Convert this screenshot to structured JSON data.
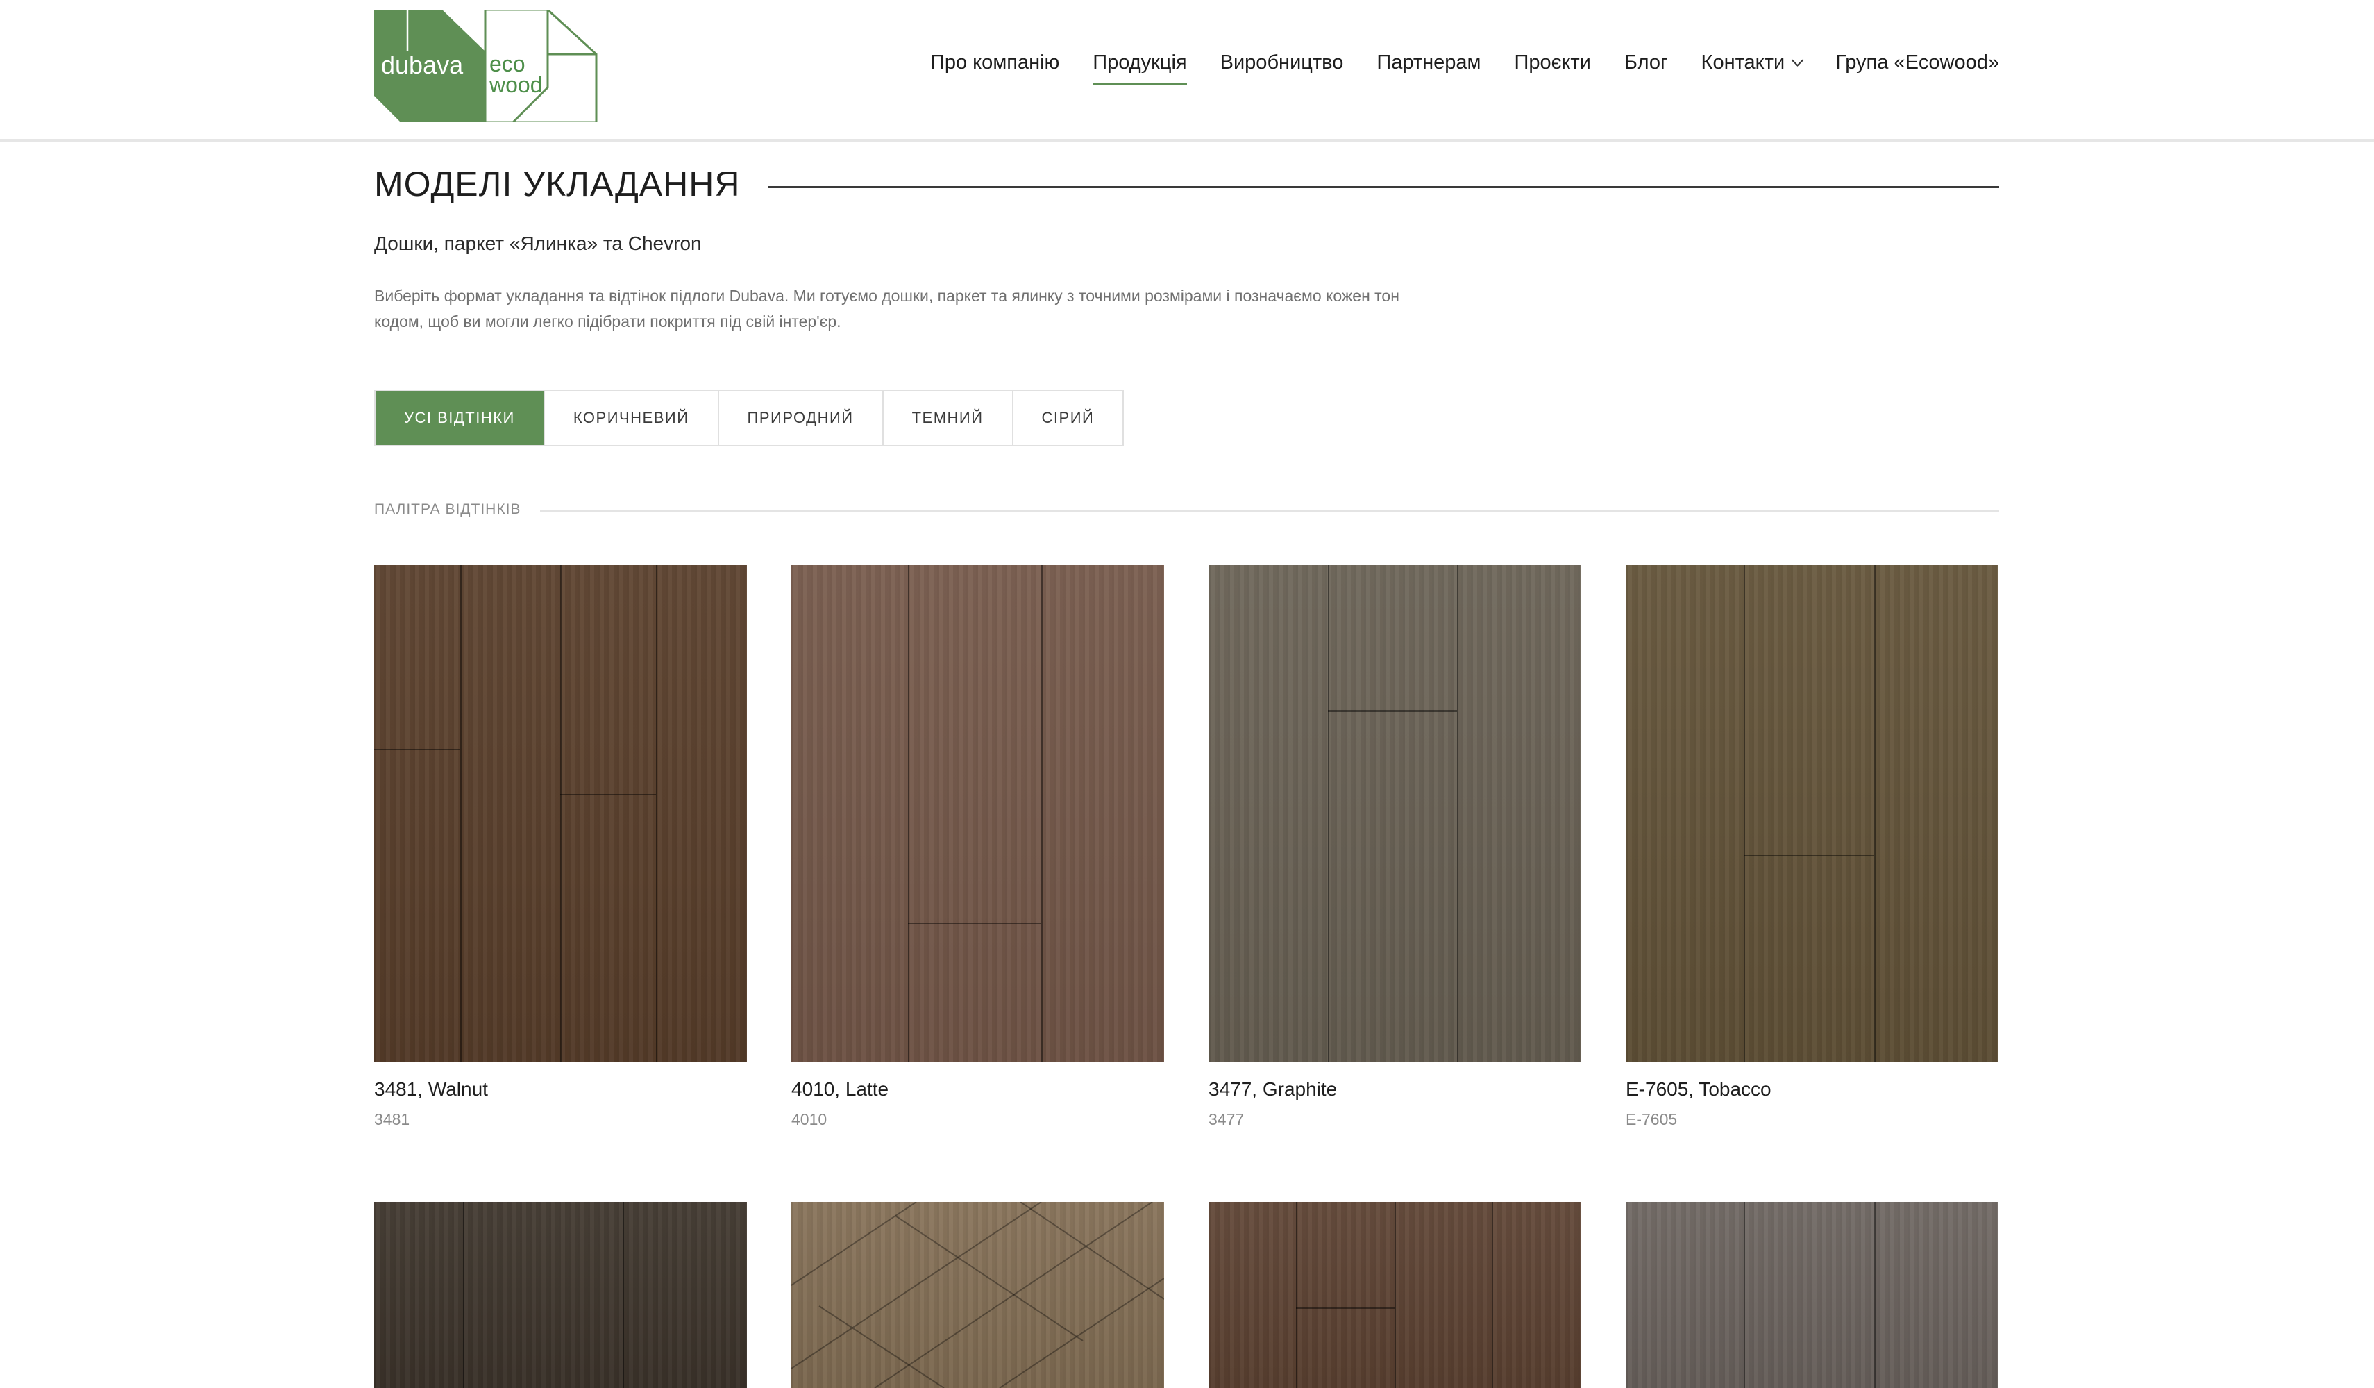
{
  "header": {
    "logo": {
      "brand": "dubava",
      "sub1": "eco",
      "sub2": "wood"
    },
    "nav": [
      {
        "label": "Про компанію",
        "active": false,
        "dropdown": false
      },
      {
        "label": "Продукція",
        "active": true,
        "dropdown": false
      },
      {
        "label": "Виробництво",
        "active": false,
        "dropdown": false
      },
      {
        "label": "Партнерам",
        "active": false,
        "dropdown": false
      },
      {
        "label": "Проєкти",
        "active": false,
        "dropdown": false
      },
      {
        "label": "Блог",
        "active": false,
        "dropdown": false
      },
      {
        "label": "Контакти",
        "active": false,
        "dropdown": true
      },
      {
        "label": "Група «Ecowood»",
        "active": false,
        "dropdown": false
      }
    ]
  },
  "main": {
    "title": "МОДЕЛІ УКЛАДАННЯ",
    "subtitle": "Дошки, паркет «Ялинка» та Chevron",
    "description": "Виберіть формат укладання та відтінок підлоги Dubava. Ми готуємо дошки, паркет та ялинку з точними розмірами і позначаємо кожен тон кодом, щоб ви могли легко підібрати покриття під свій інтер'єр.",
    "filters": [
      {
        "label": "УСІ ВІДТІНКИ",
        "active": true
      },
      {
        "label": "КОРИЧНЕВИЙ",
        "active": false
      },
      {
        "label": "ПРИРОДНИЙ",
        "active": false
      },
      {
        "label": "ТЕМНИЙ",
        "active": false
      },
      {
        "label": "СІРИЙ",
        "active": false
      }
    ],
    "palette_label": "ПАЛІТРА ВІДТІНКІВ",
    "products": [
      {
        "name": "3481, Walnut",
        "code": "3481",
        "color": "#5a3f2b"
      },
      {
        "name": "4010, Latte",
        "code": "4010",
        "color": "#76594a"
      },
      {
        "name": "3477, Graphite",
        "code": "3477",
        "color": "#6a6255"
      },
      {
        "name": "E-7605, Tobacco",
        "code": "E-7605",
        "color": "#645439"
      },
      {
        "name": "",
        "code": "",
        "color": "#3e352c"
      },
      {
        "name": "",
        "code": "",
        "color": "#857056"
      },
      {
        "name": "",
        "code": "",
        "color": "#5e4333"
      },
      {
        "name": "",
        "code": "",
        "color": "#6d6560"
      }
    ]
  },
  "colors": {
    "accent": "#5f8f55",
    "text": "#1e1e1e",
    "muted": "#8a8a8a"
  }
}
